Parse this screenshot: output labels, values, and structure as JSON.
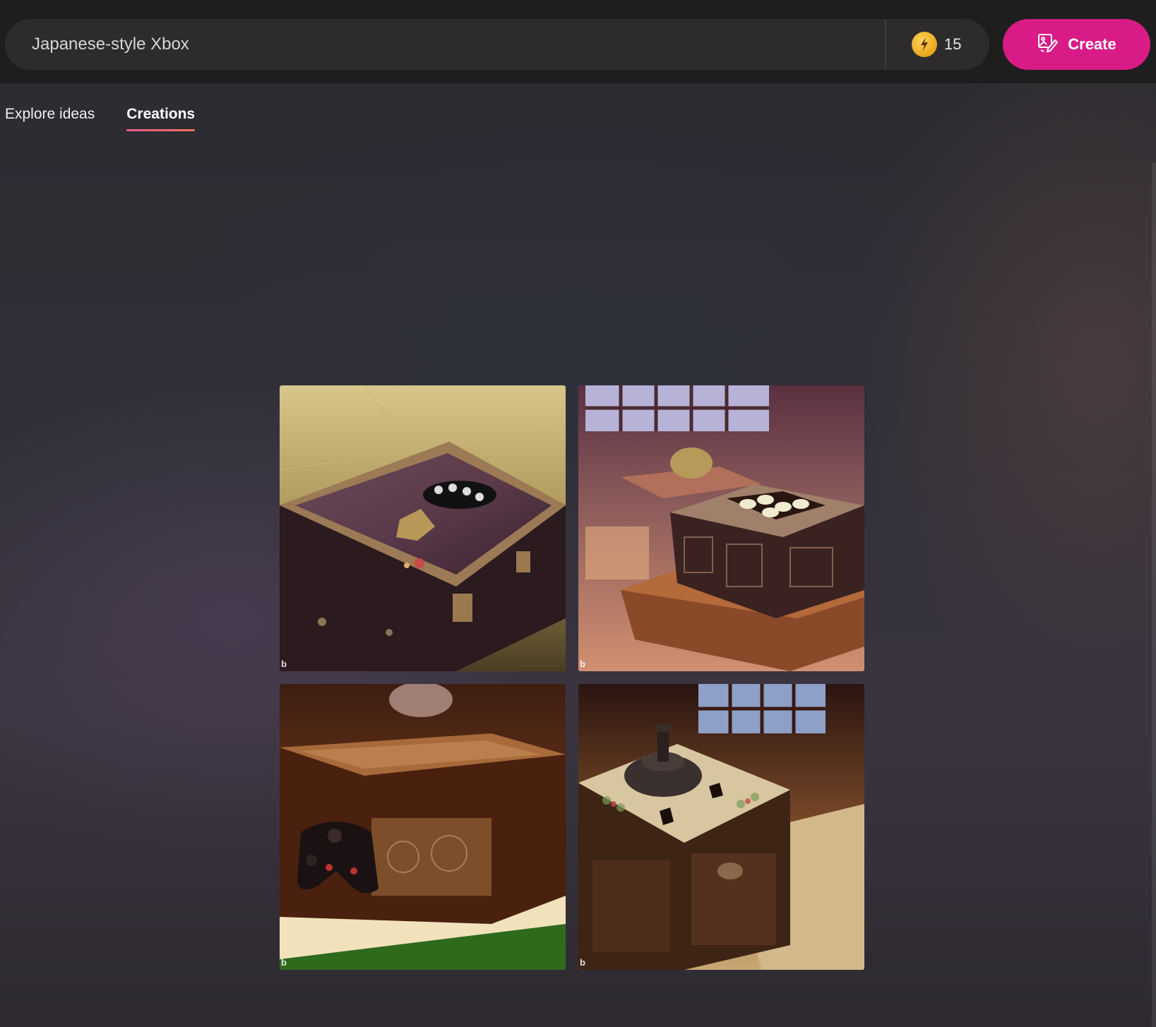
{
  "search": {
    "value": "Japanese-style Xbox"
  },
  "boosts": {
    "count": "15",
    "icon": "boost-coin-icon"
  },
  "create_button": {
    "label": "Create",
    "icon": "create-image-icon"
  },
  "tabs": [
    {
      "label": "Explore ideas",
      "active": false
    },
    {
      "label": "Creations",
      "active": true
    }
  ],
  "colors": {
    "accent": "#d81b86",
    "tab_underline": "#ec5a8c",
    "background": "#2e2d33",
    "topbar": "#1f1e1e"
  },
  "results": [
    {
      "watermark": "b"
    },
    {
      "watermark": "b"
    },
    {
      "watermark": "b"
    },
    {
      "watermark": "b"
    }
  ]
}
